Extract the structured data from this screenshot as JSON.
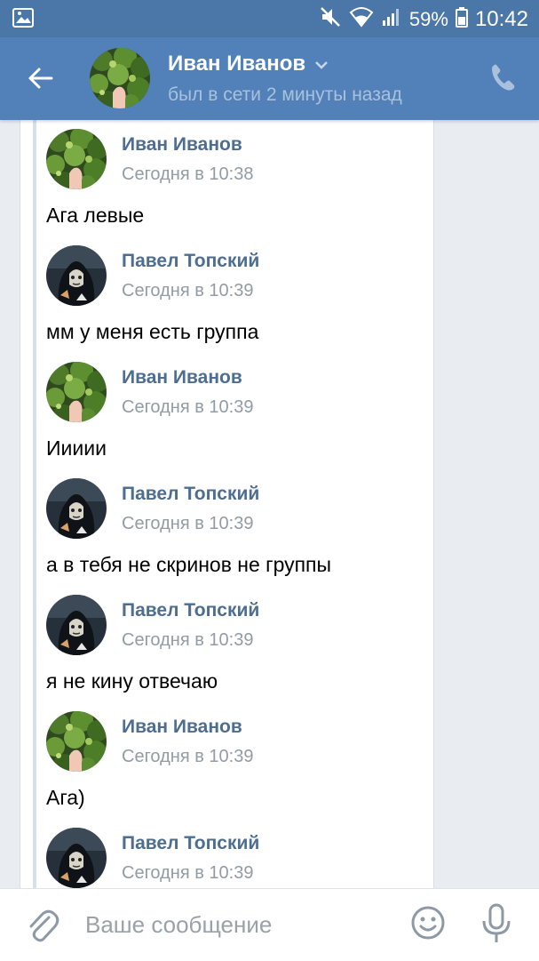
{
  "status_bar": {
    "battery": "59%",
    "time": "10:42"
  },
  "header": {
    "contact_name": "Иван Иванов",
    "last_seen": "был в сети 2 минуты назад"
  },
  "messages": [
    {
      "author": "Иван Иванов",
      "time": "Сегодня в 10:38",
      "text": "Ага левые",
      "avatar": "ivan"
    },
    {
      "author": "Павел Топский",
      "time": "Сегодня в 10:39",
      "text": "мм у меня есть группа",
      "avatar": "pavel"
    },
    {
      "author": "Иван Иванов",
      "time": "Сегодня в 10:39",
      "text": "Иииии",
      "avatar": "ivan"
    },
    {
      "author": "Павел Топский",
      "time": "Сегодня в 10:39",
      "text": "а в тебя не скринов не группы",
      "avatar": "pavel"
    },
    {
      "author": "Павел Топский",
      "time": "Сегодня в 10:39",
      "text": "я не кину отвечаю",
      "avatar": "pavel"
    },
    {
      "author": "Иван Иванов",
      "time": "Сегодня в 10:39",
      "text": "Ага)",
      "avatar": "ivan"
    },
    {
      "author": "Павел Топский",
      "time": "Сегодня в 10:39",
      "text": "",
      "avatar": "pavel"
    }
  ],
  "composer": {
    "placeholder": "Ваше сообщение"
  },
  "icons": {
    "status_bar": [
      "gallery-icon",
      "mute-icon",
      "wifi-icon",
      "signal-icon",
      "battery-icon"
    ],
    "header": [
      "back-arrow-icon",
      "chevron-down-icon",
      "phone-icon"
    ],
    "composer": [
      "attach-icon",
      "emoji-icon",
      "mic-icon"
    ]
  },
  "colors": {
    "status_bar": "#4a76a8",
    "header": "#5181b8",
    "author": "#4d6d91",
    "timestamp": "#939ba4",
    "background": "#e9edf1"
  }
}
